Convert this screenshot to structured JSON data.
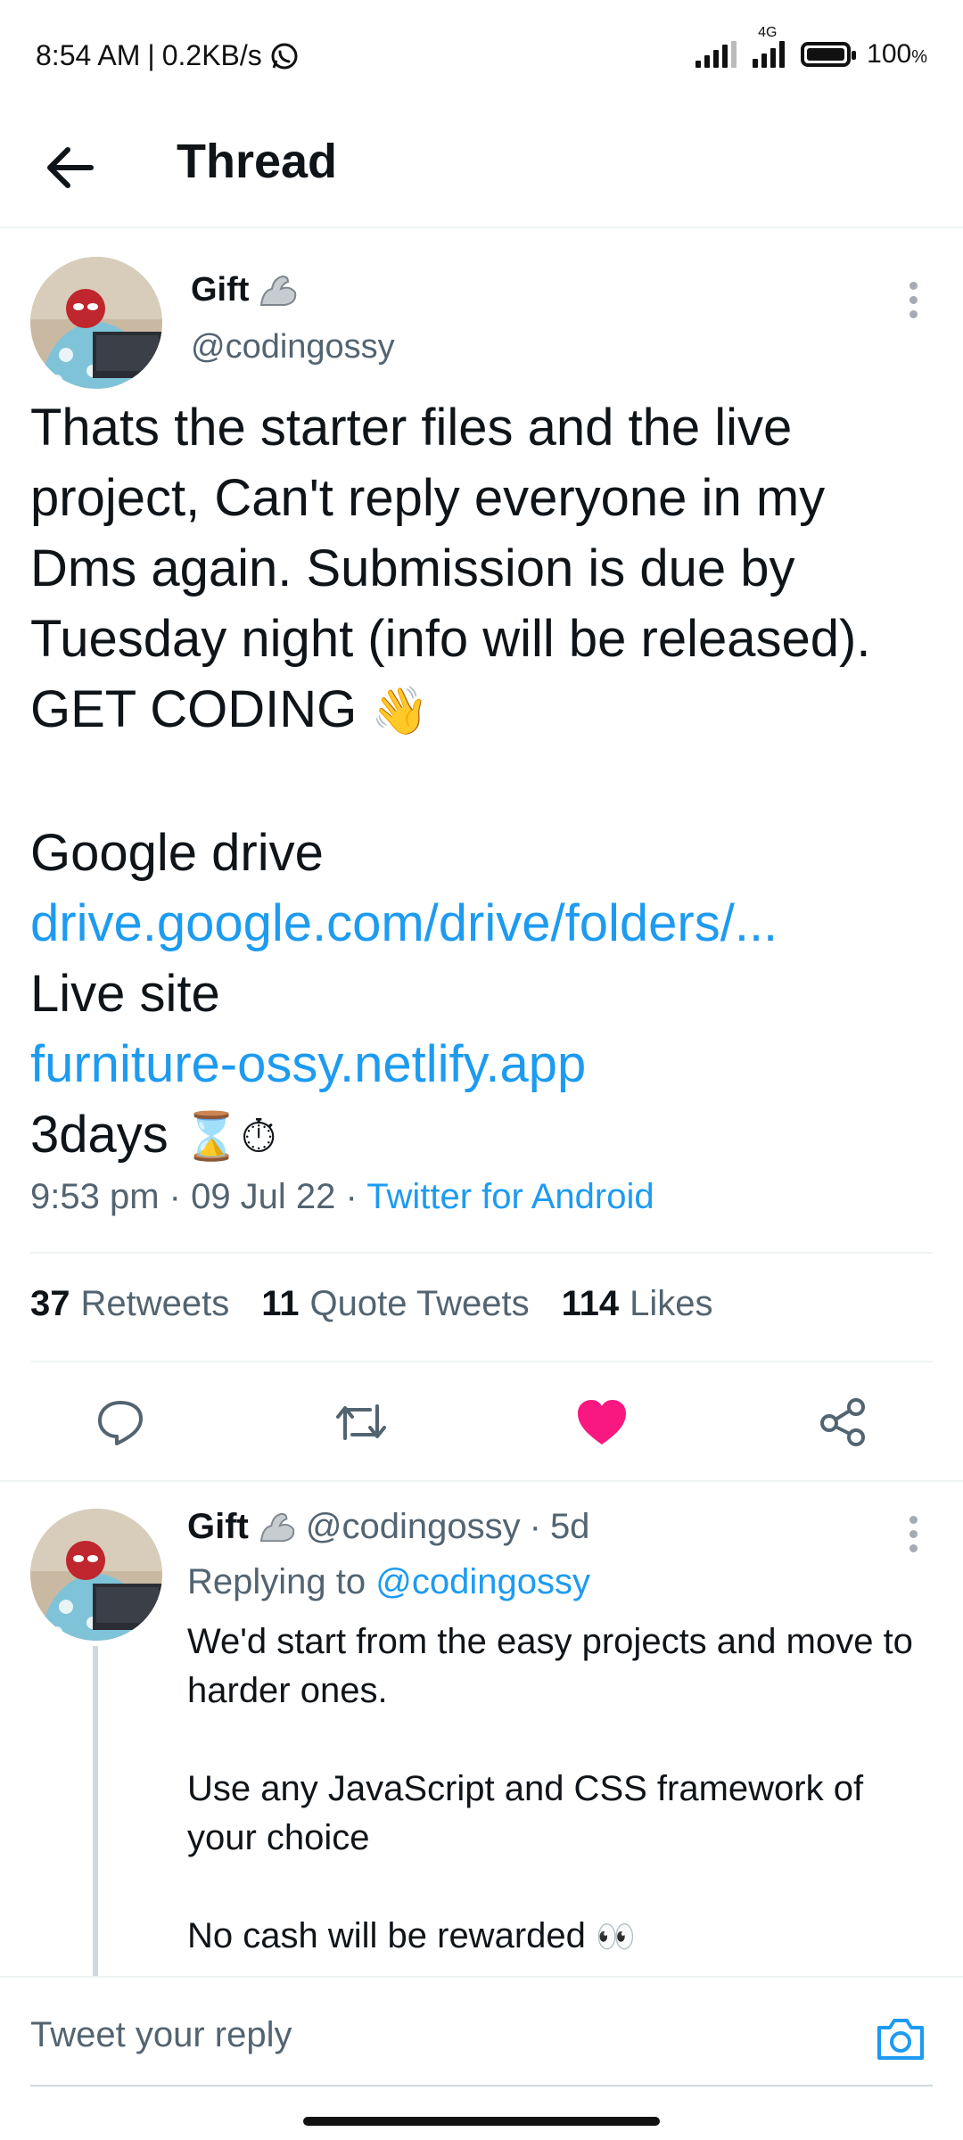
{
  "status_bar": {
    "time": "8:54 AM",
    "speed": "0.2KB/s",
    "network": "4G",
    "battery": "100",
    "battery_unit": "%"
  },
  "header": {
    "title": "Thread"
  },
  "tweet": {
    "name": "Gift",
    "handle": "@codingossy",
    "text_lines": [
      "Thats the starter files and the live",
      "project, Can't reply everyone in my",
      "Dms again. Submission is due by",
      "Tuesday night (info will be released).",
      "GET CODING "
    ],
    "google_drive_label": "Google drive",
    "drive_link": "drive.google.com/drive/folders/...",
    "live_site_label": "Live site",
    "site_link": "furniture-ossy.netlify.app",
    "days": "3days ",
    "emoji_wave": "👋",
    "emoji_hourglass": "⌛",
    "emoji_clock": "⏱",
    "time": "9:53 pm",
    "date": "09 Jul 22",
    "source": "Twitter for Android",
    "retweets_count": "37",
    "retweets_label": "Retweets",
    "quotes_count": "11",
    "quotes_label": "Quote Tweets",
    "likes_count": "114",
    "likes_label": "Likes",
    "liked": true
  },
  "reply": {
    "name": "Gift",
    "handle": "@codingossy",
    "age": "5d",
    "replying_prefix": "Replying to ",
    "replying_to": "@codingossy",
    "text": "We'd start from the easy projects and move to\nharder ones.\n\nUse any JavaScript and CSS framework of\nyour choice\n\nNo cash will be rewarded ",
    "emoji_eyes": "👀"
  },
  "composer": {
    "placeholder": "Tweet your reply"
  },
  "colors": {
    "link": "#1d9bf0",
    "like": "#f91880",
    "gray": "#536471"
  },
  "icons": [
    "back-arrow-icon",
    "more-icon",
    "reply-icon",
    "retweet-icon",
    "heart-icon",
    "share-icon",
    "camera-icon",
    "whatsapp-icon",
    "muscle-icon"
  ]
}
